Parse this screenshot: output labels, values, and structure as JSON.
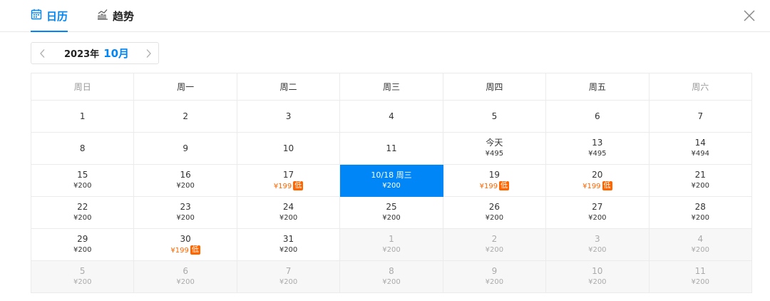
{
  "tabs": [
    {
      "label": "日历",
      "active": true,
      "icon": "calendar-icon"
    },
    {
      "label": "趋势",
      "active": false,
      "icon": "trend-chart-icon"
    }
  ],
  "close_icon": "close-icon",
  "month_nav": {
    "year": "2023年",
    "month": "10月",
    "prev_icon": "chevron-left-icon",
    "next_icon": "chevron-right-icon"
  },
  "colors": {
    "accent": "#0086f6",
    "low_price": "#ff6600",
    "other_month_bg": "#f7f7f7"
  },
  "weekdays": [
    "周日",
    "周一",
    "周二",
    "周三",
    "周四",
    "周五",
    "周六"
  ],
  "weeks": [
    [
      {
        "day": "1",
        "price": ""
      },
      {
        "day": "2",
        "price": ""
      },
      {
        "day": "3",
        "price": ""
      },
      {
        "day": "4",
        "price": ""
      },
      {
        "day": "5",
        "price": ""
      },
      {
        "day": "6",
        "price": ""
      },
      {
        "day": "7",
        "price": ""
      }
    ],
    [
      {
        "day": "8",
        "price": ""
      },
      {
        "day": "9",
        "price": ""
      },
      {
        "day": "10",
        "price": ""
      },
      {
        "day": "11",
        "price": ""
      },
      {
        "day": "今天",
        "price": "¥495"
      },
      {
        "day": "13",
        "price": "¥495"
      },
      {
        "day": "14",
        "price": "¥494"
      }
    ],
    [
      {
        "day": "15",
        "price": "¥200"
      },
      {
        "day": "16",
        "price": "¥200"
      },
      {
        "day": "17",
        "price": "¥199",
        "low": true,
        "tag": "低"
      },
      {
        "day": "10/18 周三",
        "price": "¥200",
        "selected": true
      },
      {
        "day": "19",
        "price": "¥199",
        "low": true,
        "tag": "低"
      },
      {
        "day": "20",
        "price": "¥199",
        "low": true,
        "tag": "低"
      },
      {
        "day": "21",
        "price": "¥200"
      }
    ],
    [
      {
        "day": "22",
        "price": "¥200"
      },
      {
        "day": "23",
        "price": "¥200"
      },
      {
        "day": "24",
        "price": "¥200"
      },
      {
        "day": "25",
        "price": "¥200"
      },
      {
        "day": "26",
        "price": "¥200"
      },
      {
        "day": "27",
        "price": "¥200"
      },
      {
        "day": "28",
        "price": "¥200"
      }
    ],
    [
      {
        "day": "29",
        "price": "¥200"
      },
      {
        "day": "30",
        "price": "¥199",
        "low": true,
        "tag": "低"
      },
      {
        "day": "31",
        "price": "¥200"
      },
      {
        "day": "1",
        "price": "¥200",
        "other": true
      },
      {
        "day": "2",
        "price": "¥200",
        "other": true
      },
      {
        "day": "3",
        "price": "¥200",
        "other": true
      },
      {
        "day": "4",
        "price": "¥200",
        "other": true
      }
    ],
    [
      {
        "day": "5",
        "price": "¥200",
        "other": true
      },
      {
        "day": "6",
        "price": "¥200",
        "other": true
      },
      {
        "day": "7",
        "price": "¥200",
        "other": true
      },
      {
        "day": "8",
        "price": "¥200",
        "other": true
      },
      {
        "day": "9",
        "price": "¥200",
        "other": true
      },
      {
        "day": "10",
        "price": "¥200",
        "other": true
      },
      {
        "day": "11",
        "price": "¥200",
        "other": true
      }
    ]
  ]
}
